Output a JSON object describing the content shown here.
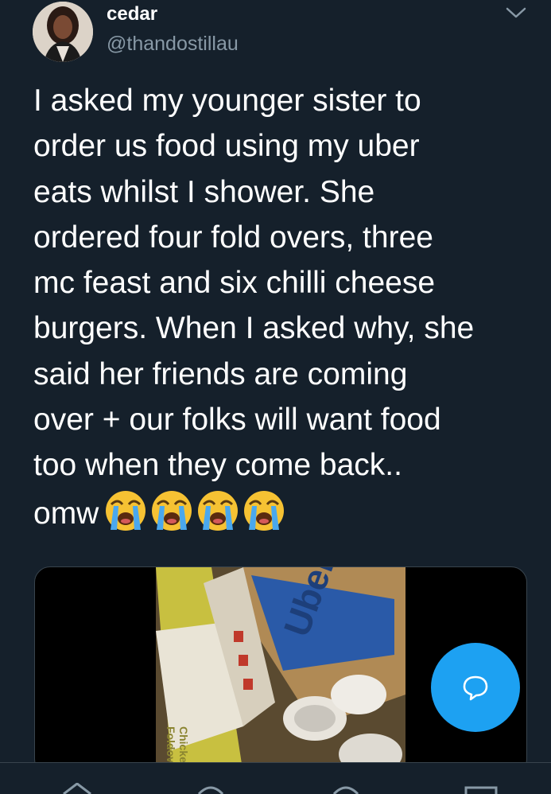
{
  "author": {
    "name": "cedar",
    "handle": "@thandostillau"
  },
  "tweet": {
    "text": "I asked my younger sister to\norder us food using my uber\neats whilst I shower. She\nordered four fold overs, three\nmc feast and six chilli cheese\nburgers. When I asked why, she\nsaid her friends are coming\nover + our folks will want food\ntoo when they come back..\nomw",
    "emoji": [
      "loudly-crying-face",
      "loudly-crying-face",
      "loudly-crying-face",
      "loudly-crying-face"
    ]
  },
  "media": {
    "packaging_text_1": "Chicken",
    "packaging_text_2": "Foldover",
    "bag_text": "Uber Eats"
  },
  "icons": {
    "more": "chevron-down-icon",
    "compose": "compose-reply-icon",
    "nav": [
      "home-icon",
      "search-icon",
      "notifications-icon",
      "messages-icon"
    ]
  },
  "colors": {
    "background": "#15202b",
    "secondary_text": "#8899a6",
    "accent": "#1da1f2",
    "divider": "#38444d"
  }
}
